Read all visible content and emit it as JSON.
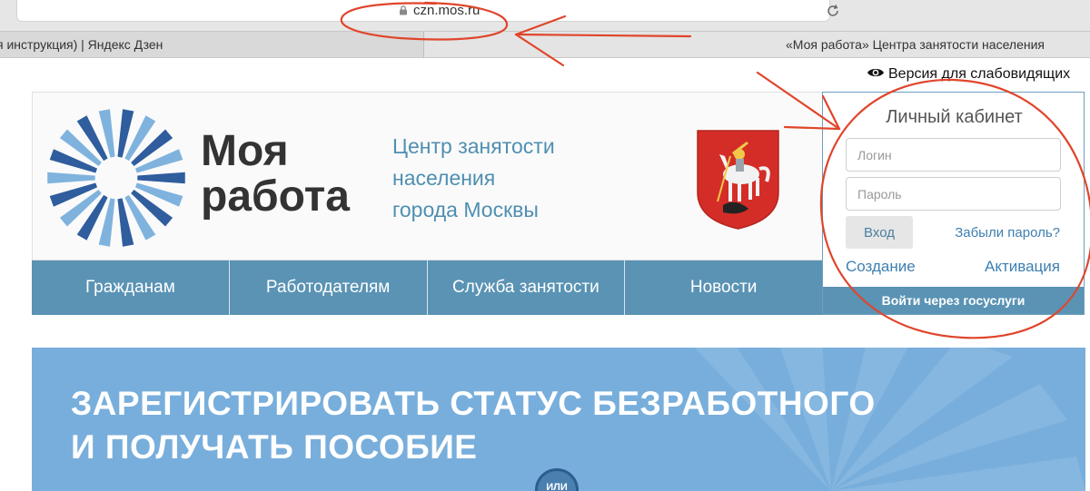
{
  "browser": {
    "url": "czn.mos.ru",
    "tabs": [
      {
        "label": "я инструкция) | Яндекс Дзен",
        "active": false
      },
      {
        "label": "«Моя работа» Центра занятости населения",
        "active": true
      }
    ]
  },
  "page": {
    "accessibility_link": "Версия для слабовидящих",
    "brand": {
      "line1": "Моя",
      "line2": "работа"
    },
    "center_name": {
      "line1": "Центр занятости",
      "line2": "населения",
      "line3": "города Москвы"
    },
    "nav": [
      "Гражданам",
      "Работодателям",
      "Служба занятости",
      "Новости"
    ],
    "login": {
      "title": "Личный кабинет",
      "login_placeholder": "Логин",
      "password_placeholder": "Пароль",
      "submit": "Вход",
      "forgot": "Забыли пароль?",
      "create": "Создание",
      "activate": "Активация",
      "gosuslugi": "Войти через госуслуги"
    },
    "banner": {
      "line1": "ЗАРЕГИСТРИРОВАТЬ СТАТУС БЕЗРАБОТНОГО",
      "line2": "И ПОЛУЧАТЬ ПОСОБИЕ",
      "badge": "ИЛИ"
    }
  },
  "colors": {
    "accent": "#5a93b4",
    "banner": "#78aedb",
    "annotation": "#e0452b",
    "logo_dark": "#2f5d9e",
    "logo_light": "#7fb3de"
  },
  "icons": [
    "lock-icon",
    "reload-icon",
    "eye-icon",
    "logo-icon",
    "moscow-coat-of-arms-icon"
  ]
}
